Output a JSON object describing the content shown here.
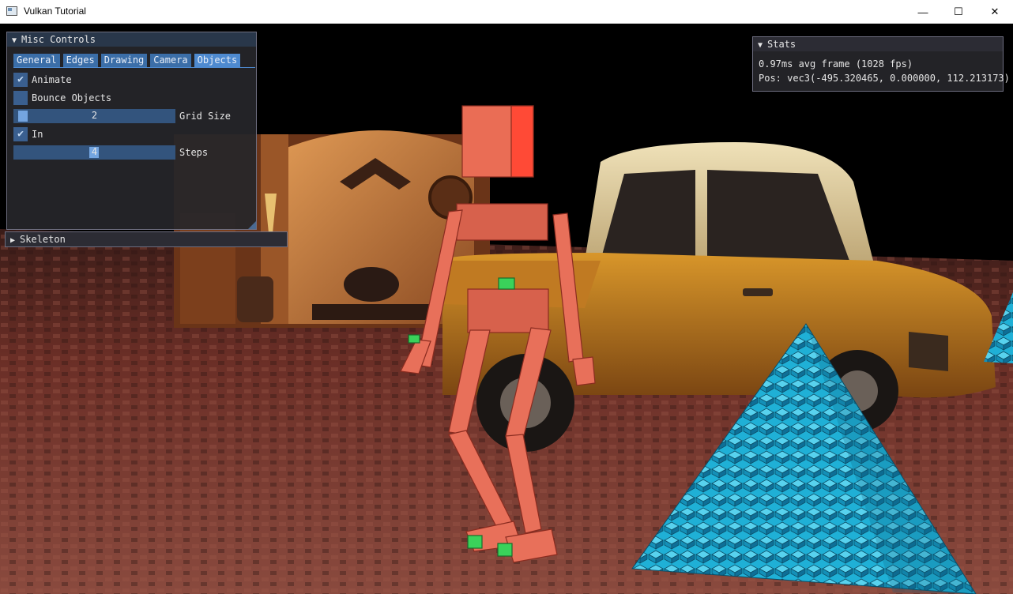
{
  "window": {
    "title": "Vulkan Tutorial",
    "minimize": "—",
    "maximize": "☐",
    "close": "✕"
  },
  "misc_controls": {
    "title": "Misc Controls",
    "tabs": [
      "General",
      "Edges",
      "Drawing",
      "Camera",
      "Objects"
    ],
    "active_tab": "Objects",
    "animate_label": "Animate",
    "animate_checked": true,
    "bounce_label": "Bounce Objects",
    "bounce_checked": false,
    "grid_size_label": "Grid Size",
    "grid_size_value": "2",
    "in_label": "In",
    "in_checked": true,
    "steps_label": "Steps",
    "steps_value": "4"
  },
  "skeleton": {
    "title": "Skeleton"
  },
  "stats": {
    "title": "Stats",
    "frame_line": "0.97ms avg frame (1028 fps)",
    "pos_line": "Pos: vec3(-495.320465, 0.000000, 112.213173)"
  },
  "colors": {
    "panel_header": "#29374a",
    "tab": "#3b6ea8",
    "tab_active": "#4e8ad0",
    "checkbox": "#3a5f8f",
    "pyramid": "#22b3d6",
    "skeleton": "#e8705a",
    "car": "#c9861f"
  },
  "icons": {
    "expanded": "triangle-down-icon",
    "collapsed": "triangle-right-icon",
    "check": "check-icon"
  }
}
